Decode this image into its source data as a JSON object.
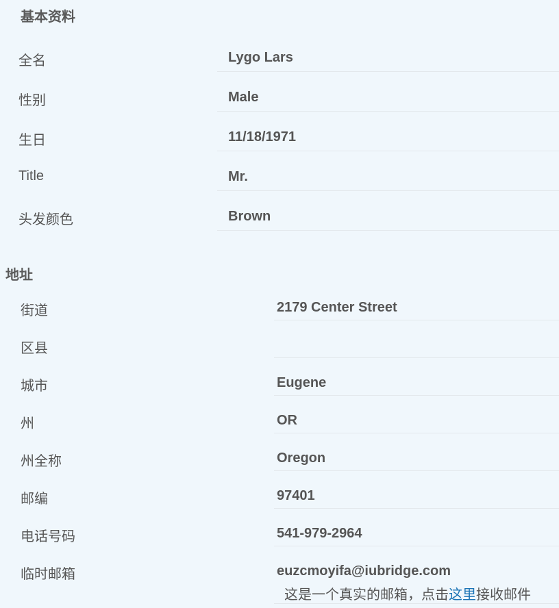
{
  "basic_info": {
    "title": "基本资料",
    "fields": [
      {
        "label": "全名",
        "value": "Lygo Lars"
      },
      {
        "label": "性别",
        "value": "Male"
      },
      {
        "label": "生日",
        "value": "11/18/1971"
      },
      {
        "label": "Title",
        "value": "Mr."
      },
      {
        "label": "头发颜色",
        "value": "Brown"
      }
    ]
  },
  "address": {
    "title": "地址",
    "fields": [
      {
        "label": "街道",
        "value": "2179  Center Street"
      },
      {
        "label": "区县",
        "value": ""
      },
      {
        "label": "城市",
        "value": "Eugene"
      },
      {
        "label": "州",
        "value": "OR"
      },
      {
        "label": "州全称",
        "value": "Oregon"
      },
      {
        "label": "邮编",
        "value": "97401"
      },
      {
        "label": "电话号码",
        "value": "541-979-2964"
      },
      {
        "label": "临时邮箱",
        "value": "euzcmoyifa@iubridge.com"
      }
    ],
    "email_note": {
      "prefix": "这是一个真实的邮箱，点击",
      "link": "这里",
      "suffix": "接收邮件"
    }
  },
  "colors": {
    "background": "#f0f7fc",
    "text": "#555555",
    "link": "#1a73b5",
    "divider": "#e3e8ec"
  }
}
